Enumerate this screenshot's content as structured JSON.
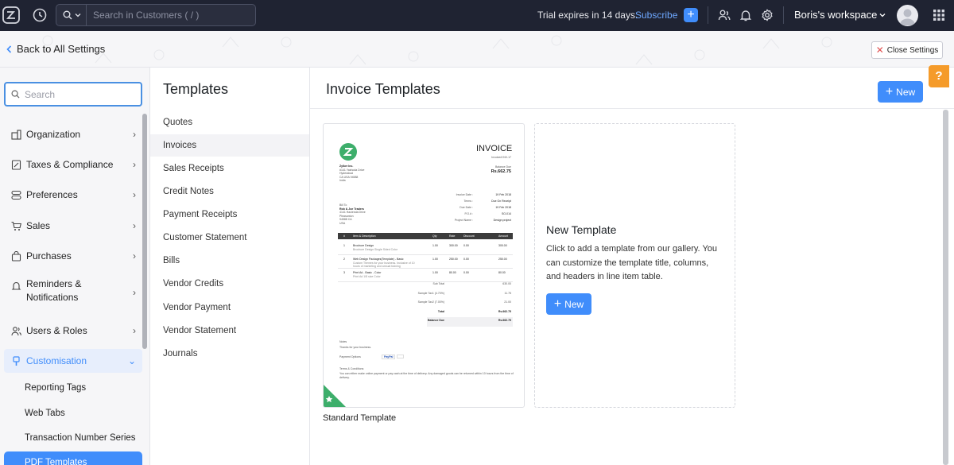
{
  "topbar": {
    "search_scope": "Q",
    "search_placeholder": "Search in Customers ( / )",
    "trial_text": "Trial expires in 14 days.",
    "subscribe_label": "Subscribe",
    "plus_label": "+",
    "workspace_label": "Boris's workspace"
  },
  "header": {
    "back_label": "Back to All Settings",
    "close_label": "Close Settings"
  },
  "leftnav": {
    "search_placeholder": "Search",
    "items": [
      {
        "label": "Organization"
      },
      {
        "label": "Taxes & Compliance"
      },
      {
        "label": "Preferences"
      },
      {
        "label": "Sales"
      },
      {
        "label": "Purchases"
      },
      {
        "label": "Reminders &"
      },
      {
        "label": "Users & Roles"
      },
      {
        "label": "Customisation"
      }
    ],
    "reminders_line2": "Notifications",
    "sub_items": [
      {
        "label": "Reporting Tags"
      },
      {
        "label": "Web Tabs"
      },
      {
        "label": "Transaction Number Series"
      },
      {
        "label": "PDF Templates"
      }
    ]
  },
  "templates": {
    "title": "Templates",
    "items": [
      {
        "label": "Quotes"
      },
      {
        "label": "Invoices"
      },
      {
        "label": "Sales Receipts"
      },
      {
        "label": "Credit Notes"
      },
      {
        "label": "Payment Receipts"
      },
      {
        "label": "Customer Statement"
      },
      {
        "label": "Bills"
      },
      {
        "label": "Vendor Credits"
      },
      {
        "label": "Vendor Payment"
      },
      {
        "label": "Vendor Statement"
      },
      {
        "label": "Journals"
      }
    ],
    "active_index": 1
  },
  "main": {
    "title": "Invoice Templates",
    "new_label": "New",
    "help_label": "?",
    "standard_caption": "Standard Template",
    "new_card_title": "New Template",
    "new_card_desc": "Click to add a template from our gallery. You can customize the template title, columns, and headers in line item table.",
    "new_card_btn": "New"
  },
  "invoice_preview": {
    "heading": "INVOICE",
    "number": "Invoice# INV-17",
    "balance_label": "Balance Due",
    "balance": "Rs.662.75",
    "company_lines": [
      "Zylker Inc.",
      "#141 Yashoda Drive",
      "Hyderabad",
      "CA USA 94588",
      "India"
    ],
    "meta_rows": [
      [
        "Invoice Date :",
        "19 Feb 2018"
      ],
      [
        "Terms :",
        "Due On Receipt"
      ],
      [
        "Due Date :",
        "19 Feb 2018"
      ],
      [
        "P.O.# :",
        "SO-014"
      ],
      [
        "Project Name :",
        "Design project"
      ]
    ],
    "billto_lines": [
      "Bill To",
      "Rob & Joe Traders",
      "4141 Hacienda Drive",
      "Pleasanton",
      "94588 CA",
      "USA"
    ],
    "table_head": [
      "#",
      "Item & Description",
      "Qty",
      "Rate",
      "Discount",
      "Amount"
    ],
    "table_rows": [
      [
        "1",
        "Brochure Design",
        "1.00",
        "300.00",
        "0.00",
        "300.00"
      ],
      [
        "2",
        "Web Design Packages(Template) - Basic",
        "1.00",
        "250.00",
        "0.00",
        "250.00"
      ],
      [
        "3",
        "Print Ad - Basic - Color",
        "1.00",
        "80.00",
        "0.00",
        "80.00"
      ]
    ],
    "row_desc": [
      "Brochure Design Single Sided Color",
      "Custom Themes for your business. Inclusive of 10 hours of marketing and annual training",
      "Print Ad 1/8 size Color"
    ],
    "totals": [
      [
        "Sub Total",
        "630.00"
      ],
      [
        "Sample Tax1 (4.70%)",
        "11.75"
      ],
      [
        "Sample Tax2 (7.00%)",
        "21.00"
      ],
      [
        "Total",
        "Rs.662.75"
      ],
      [
        "Balance Due",
        "Rs.662.75"
      ]
    ],
    "notes_label": "Notes",
    "notes_text": "Thanks for your business.",
    "payment_label": "Payment Options",
    "paypal": "PayPal",
    "terms_label": "Terms & Conditions",
    "terms_text": "You can either make online payment or pay cash at the time of delivery. Any damaged goods can be returned within 10 hours from the time of delivery."
  }
}
